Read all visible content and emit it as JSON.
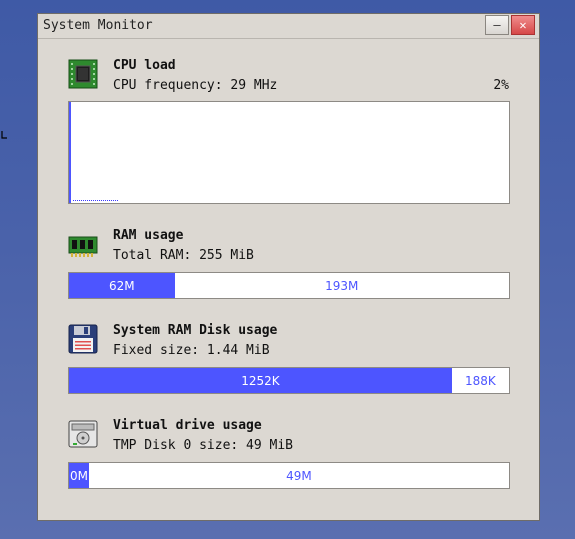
{
  "window": {
    "title": "System Monitor",
    "minimize_glyph": "–",
    "close_glyph": "✕"
  },
  "cpu": {
    "heading": "CPU load",
    "frequency": "CPU frequency: 29 MHz",
    "percent": "2%",
    "icon": "cpu-chip-icon"
  },
  "ram": {
    "heading": "RAM usage",
    "total": "Total RAM: 255 MiB",
    "used_label": "62M",
    "free_label": "193M",
    "used_fraction": 0.24,
    "icon": "memory-module-icon"
  },
  "ramdisk": {
    "heading": "System RAM Disk usage",
    "size": "Fixed size: 1.44 MiB",
    "used_label": "1252K",
    "free_label": "188K",
    "used_fraction": 0.87,
    "icon": "floppy-disk-icon"
  },
  "vdrive": {
    "heading": "Virtual drive usage",
    "size": "TMP Disk 0 size: 49 MiB",
    "used_label": "0M",
    "free_label": "49M",
    "used_fraction": 0.045,
    "icon": "hard-drive-icon"
  },
  "colors": {
    "bar_fill": "#4d55ff",
    "window_bg": "#dcd8d2",
    "desktop": "#4a62aa"
  }
}
